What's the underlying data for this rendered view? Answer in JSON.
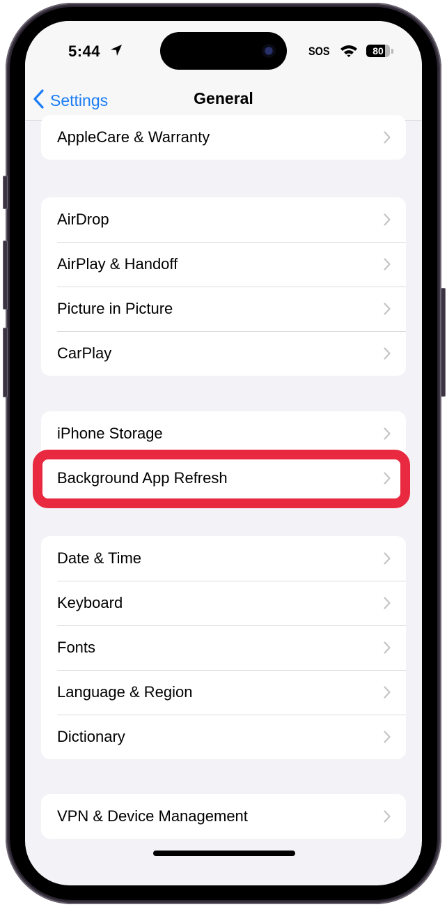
{
  "status_bar": {
    "time": "5:44",
    "location_icon": "location-arrow-icon",
    "carrier": "SOS",
    "wifi_icon": "wifi-icon",
    "battery_percent": "80"
  },
  "nav": {
    "back_label": "Settings",
    "back_icon": "chevron-left-icon",
    "title": "General"
  },
  "groups": [
    {
      "items": [
        {
          "label": "AppleCare & Warranty"
        }
      ]
    },
    {
      "items": [
        {
          "label": "AirDrop"
        },
        {
          "label": "AirPlay & Handoff"
        },
        {
          "label": "Picture in Picture"
        },
        {
          "label": "CarPlay"
        }
      ]
    },
    {
      "items": [
        {
          "label": "iPhone Storage"
        },
        {
          "label": "Background App Refresh",
          "highlighted": true
        }
      ]
    },
    {
      "items": [
        {
          "label": "Date & Time"
        },
        {
          "label": "Keyboard"
        },
        {
          "label": "Fonts"
        },
        {
          "label": "Language & Region"
        },
        {
          "label": "Dictionary"
        }
      ]
    },
    {
      "items": [
        {
          "label": "VPN & Device Management"
        }
      ]
    }
  ],
  "colors": {
    "accent": "#1a7cf5",
    "highlight": "#e8293f",
    "background": "#f2f2f7"
  }
}
